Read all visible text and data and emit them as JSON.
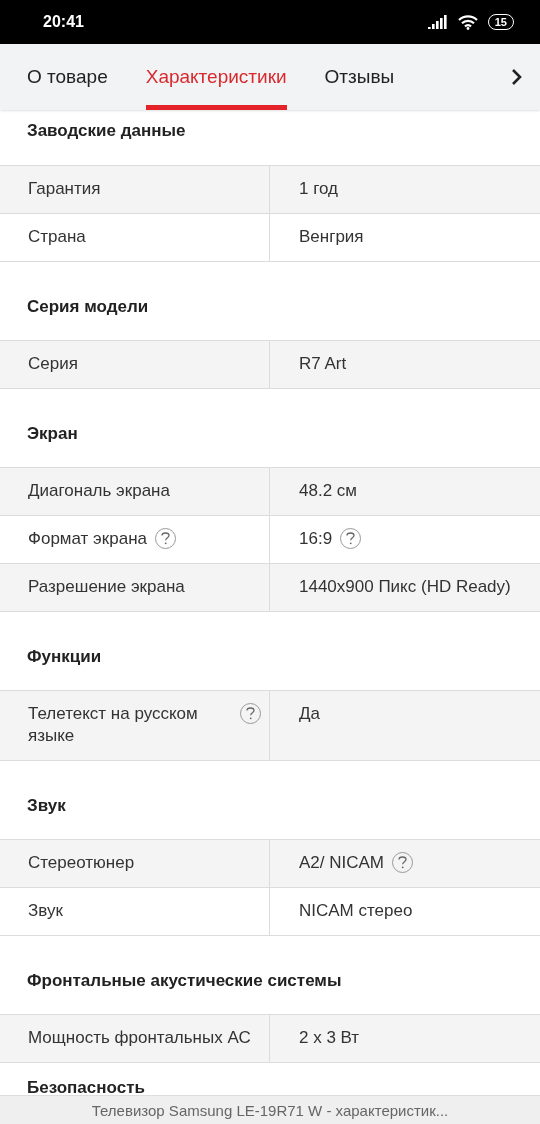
{
  "status_bar": {
    "time": "20:41",
    "battery": "15"
  },
  "tabs": [
    {
      "label": "О товаре",
      "selected": false
    },
    {
      "label": "Характеристики",
      "selected": true
    },
    {
      "label": "Отзывы",
      "selected": false
    }
  ],
  "sections": [
    {
      "title": "Заводские данные",
      "rows": [
        {
          "label": "Гарантия",
          "value": "1 год",
          "label_help": false,
          "value_help": false
        },
        {
          "label": "Страна",
          "value": "Венгрия",
          "label_help": false,
          "value_help": false
        }
      ]
    },
    {
      "title": "Серия модели",
      "rows": [
        {
          "label": "Серия",
          "value": "R7 Art",
          "label_help": false,
          "value_help": false
        }
      ]
    },
    {
      "title": "Экран",
      "rows": [
        {
          "label": "Диагональ экрана",
          "value": "48.2 см",
          "label_help": false,
          "value_help": false
        },
        {
          "label": "Формат экрана",
          "value": "16:9",
          "label_help": true,
          "value_help": true
        },
        {
          "label": "Разрешение экрана",
          "value": "1440x900 Пикс (HD Ready)",
          "label_help": false,
          "value_help": false
        }
      ]
    },
    {
      "title": "Функции",
      "rows": [
        {
          "label": "Телетекст на русском языке",
          "value": "Да",
          "label_help": true,
          "value_help": false
        }
      ]
    },
    {
      "title": "Звук",
      "rows": [
        {
          "label": "Стереотюнер",
          "value": "A2/ NICAM",
          "label_help": false,
          "value_help": true
        },
        {
          "label": "Звук",
          "value": "NICAM стерео",
          "label_help": false,
          "value_help": false
        }
      ]
    },
    {
      "title": "Фронтальные акустические системы",
      "rows": [
        {
          "label": "Мощность фронтальных АС",
          "value": "2 x 3 Вт",
          "label_help": false,
          "value_help": false
        }
      ]
    },
    {
      "title": "Безопасность"
    }
  ],
  "page_title": "Телевизор Samsung LE-19R71 W - характеристик..."
}
